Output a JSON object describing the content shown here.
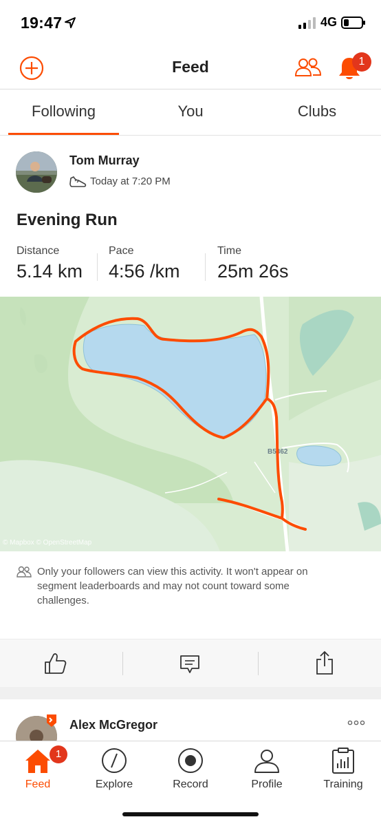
{
  "status_bar": {
    "time": "19:47",
    "network": "4G"
  },
  "header": {
    "title": "Feed",
    "notification_count": "1"
  },
  "tabs": [
    {
      "label": "Following",
      "active": true
    },
    {
      "label": "You",
      "active": false
    },
    {
      "label": "Clubs",
      "active": false
    }
  ],
  "activity": {
    "athlete_name": "Tom Murray",
    "time": "Today at 7:20 PM",
    "title": "Evening Run",
    "stats": [
      {
        "label": "Distance",
        "value": "5.14 km"
      },
      {
        "label": "Pace",
        "value": "4:56 /km"
      },
      {
        "label": "Time",
        "value": "25m 26s"
      }
    ],
    "map": {
      "road_label": "B5362",
      "attribution": "© Mapbox © OpenStreetMap",
      "route_color": "#fc4c02"
    },
    "privacy_note": "Only your followers can view this activity. It won't appear on segment leaderboards and may not count toward some challenges."
  },
  "next_activity": {
    "athlete_name": "Alex McGregor"
  },
  "bottom_nav": [
    {
      "label": "Feed",
      "icon": "home-icon",
      "active": true,
      "badge": "1"
    },
    {
      "label": "Explore",
      "icon": "compass-icon",
      "active": false
    },
    {
      "label": "Record",
      "icon": "record-icon",
      "active": false
    },
    {
      "label": "Profile",
      "icon": "profile-icon",
      "active": false
    },
    {
      "label": "Training",
      "icon": "training-icon",
      "active": false
    }
  ],
  "colors": {
    "accent": "#fc4c02",
    "badge": "#e2361c"
  }
}
